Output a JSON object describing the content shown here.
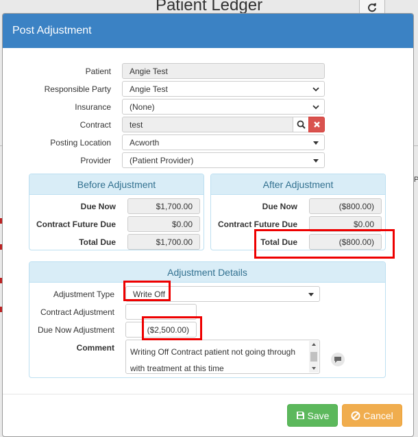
{
  "background": {
    "title": "Patient Ledger",
    "right_edge_text": "P"
  },
  "modal": {
    "title": "Post Adjustment",
    "fields": {
      "patient": {
        "label": "Patient",
        "value": "Angie Test"
      },
      "responsible_party": {
        "label": "Responsible Party",
        "value": "Angie Test"
      },
      "insurance": {
        "label": "Insurance",
        "value": "(None)"
      },
      "contract": {
        "label": "Contract",
        "value": "test"
      },
      "posting_location": {
        "label": "Posting Location",
        "value": "Acworth"
      },
      "provider": {
        "label": "Provider",
        "value": "(Patient Provider)"
      }
    },
    "before": {
      "title": "Before Adjustment",
      "due_now_label": "Due Now",
      "due_now": "$1,700.00",
      "future_label": "Contract Future Due",
      "future": "$0.00",
      "total_label": "Total Due",
      "total": "$1,700.00"
    },
    "after": {
      "title": "After Adjustment",
      "due_now_label": "Due Now",
      "due_now": "($800.00)",
      "future_label": "Contract Future Due",
      "future": "$0.00",
      "total_label": "Total Due",
      "total": "($800.00)"
    },
    "details": {
      "title": "Adjustment Details",
      "type_label": "Adjustment Type",
      "type_value": "Write Off",
      "contract_adj_label": "Contract Adjustment",
      "contract_adj_value": "",
      "due_now_adj_label": "Due Now Adjustment",
      "due_now_adj_value": "($2,500.00)",
      "comment_label": "Comment",
      "comment_value": "Writing Off Contract patient not going through with treatment at this time"
    },
    "buttons": {
      "save": "Save",
      "cancel": "Cancel"
    }
  },
  "colors": {
    "header": "#3b82c4",
    "panel_head": "#d9edf7",
    "panel_text": "#31708f",
    "save": "#5cb85c",
    "cancel": "#f0ad4e",
    "highlight": "#e00000",
    "danger": "#d9534f"
  },
  "icons": [
    "refresh-icon",
    "chevron-down-icon",
    "caret-down-icon",
    "search-icon",
    "close-icon",
    "comment-icon",
    "save-icon",
    "cancel-icon"
  ]
}
